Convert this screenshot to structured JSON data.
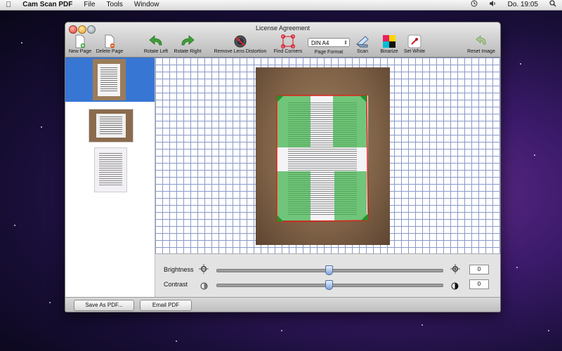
{
  "menubar": {
    "app_name": "Cam Scan PDF",
    "menus": [
      "File",
      "Tools",
      "Window"
    ],
    "clock": "Do. 19:05"
  },
  "window": {
    "title": "License Agreement"
  },
  "toolbar": {
    "new_page": "New Page",
    "delete_page": "Delete Page",
    "rotate_left": "Rotate Left",
    "rotate_right": "Rotate Right",
    "remove_lens_distortion": "Remove Lens Distortion",
    "find_corners": "Find Corners",
    "page_format_label": "Page Format",
    "page_format_value": "DIN A4",
    "scan": "Scan",
    "binarize": "Binarize",
    "set_white": "Set White",
    "reset_image": "Reset Image"
  },
  "adjustments": {
    "brightness_label": "Brightness",
    "brightness_value": "0",
    "brightness_level": 0.5,
    "contrast_label": "Contrast",
    "contrast_value": "0",
    "contrast_level": 0.5
  },
  "bottom": {
    "save_pdf": "Save As PDF...",
    "email_pdf": "Email PDF"
  },
  "colors": {
    "selection": "#3876d4",
    "overlay_green": "#3fb34a",
    "crop_line": "#e0201c"
  }
}
